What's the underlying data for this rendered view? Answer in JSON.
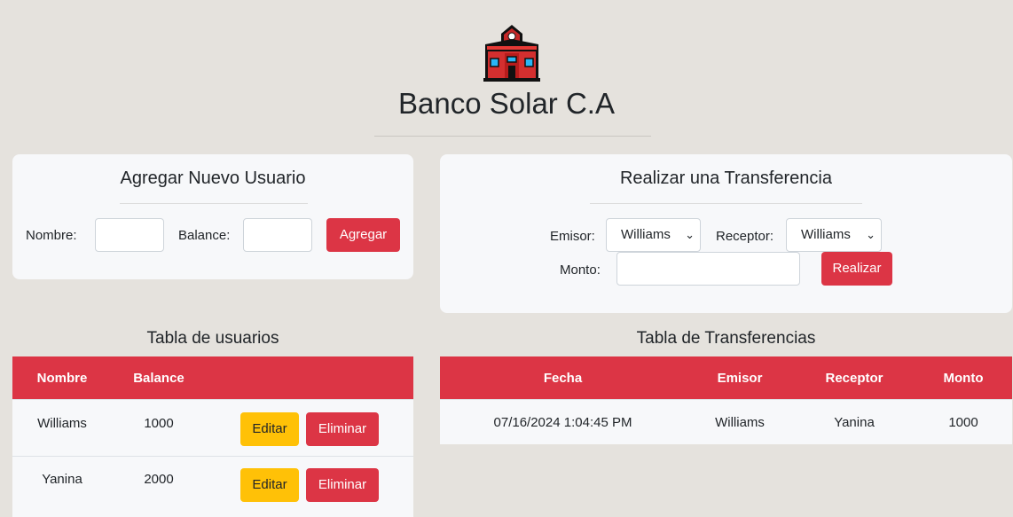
{
  "header": {
    "title": "Banco Solar C.A",
    "logo_icon": "school-building-icon"
  },
  "add_user": {
    "title": "Agregar Nuevo Usuario",
    "nombre_label": "Nombre:",
    "balance_label": "Balance:",
    "nombre_value": "",
    "balance_value": "",
    "submit_label": "Agregar"
  },
  "transfer": {
    "title": "Realizar una Transferencia",
    "emisor_label": "Emisor:",
    "emisor_value": "Williams",
    "receptor_label": "Receptor:",
    "receptor_value": "Williams",
    "monto_label": "Monto:",
    "monto_value": "",
    "submit_label": "Realizar"
  },
  "users_table": {
    "title": "Tabla de usuarios",
    "columns": [
      "Nombre",
      "Balance",
      ""
    ],
    "rows": [
      {
        "nombre": "Williams",
        "balance": "1000",
        "edit_label": "Editar",
        "delete_label": "Eliminar"
      },
      {
        "nombre": "Yanina",
        "balance": "2000",
        "edit_label": "Editar",
        "delete_label": "Eliminar"
      }
    ]
  },
  "transfers_table": {
    "title": "Tabla de Transferencias",
    "columns": [
      "Fecha",
      "Emisor",
      "Receptor",
      "Monto"
    ],
    "rows": [
      {
        "fecha": "07/16/2024 1:04:45 PM",
        "emisor": "Williams",
        "receptor": "Yanina",
        "monto": "1000"
      }
    ]
  },
  "colors": {
    "primary": "#dc3545",
    "warning": "#ffc107",
    "background": "#e5e2dd",
    "card": "#f7f8fa"
  }
}
